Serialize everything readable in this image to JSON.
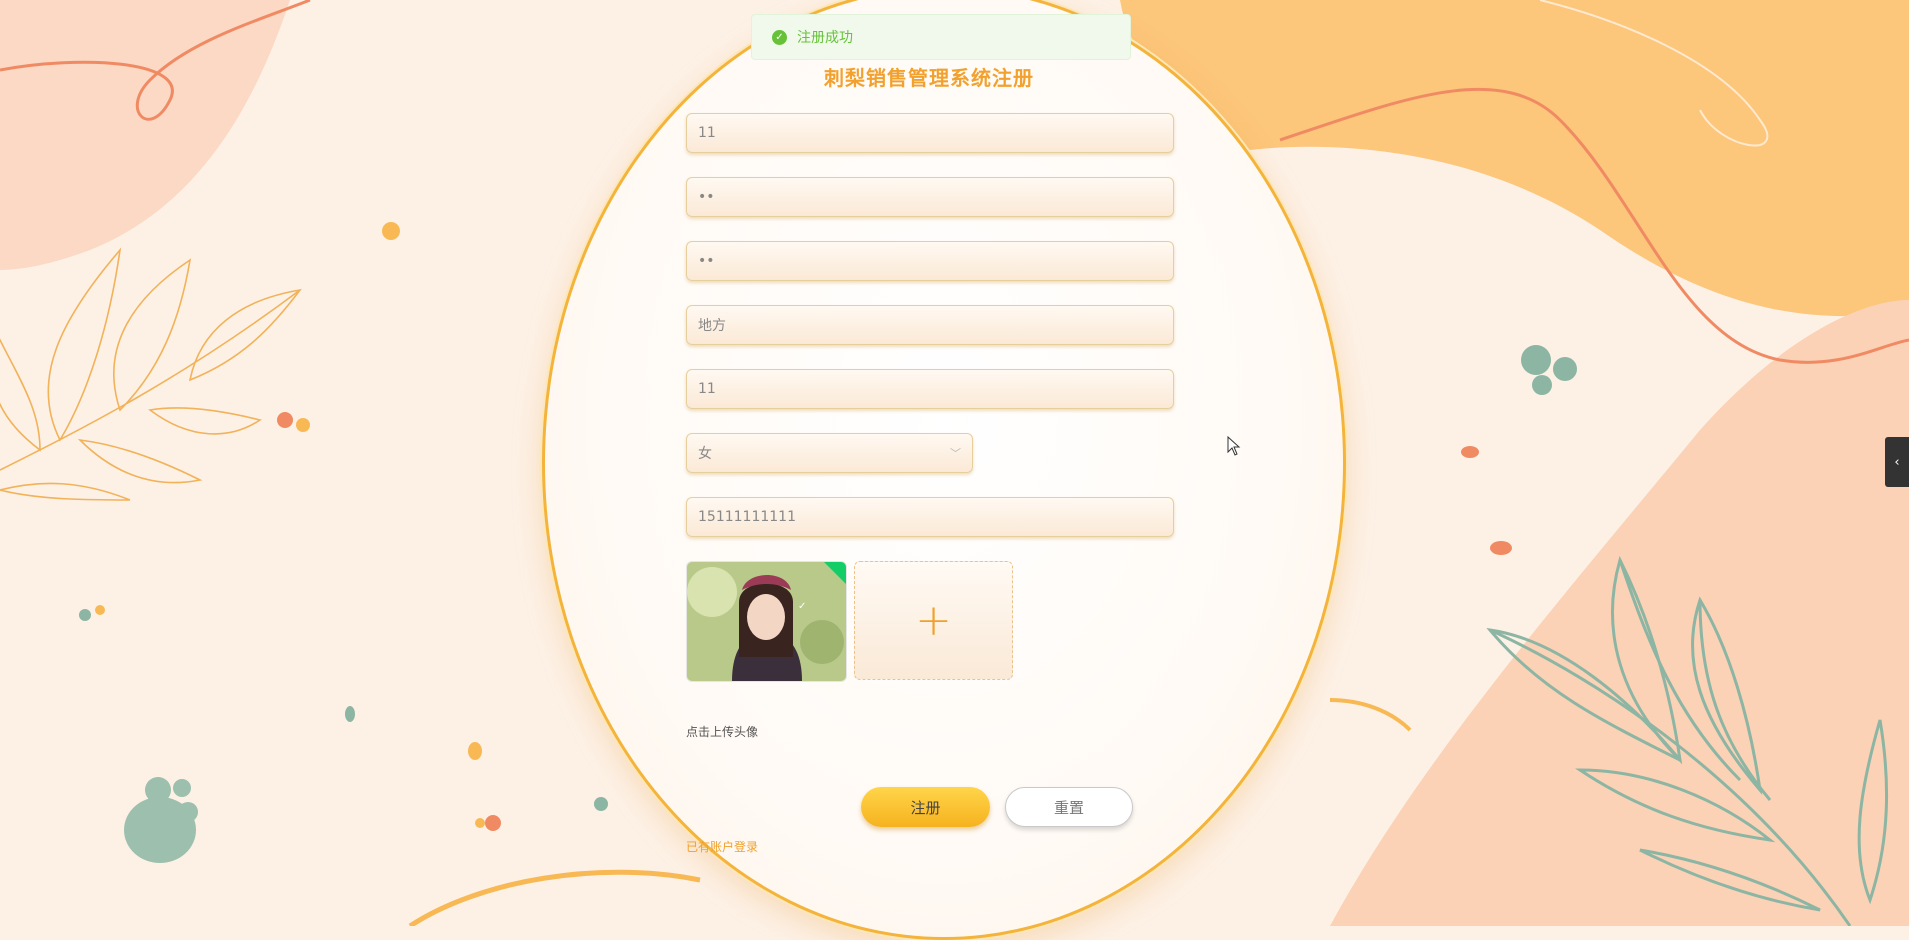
{
  "toast": {
    "message": "注册成功"
  },
  "form": {
    "title": "刺梨销售管理系统注册",
    "fields": [
      {
        "value": "11"
      },
      {
        "value": "••"
      },
      {
        "value": "••"
      },
      {
        "value": "地方"
      },
      {
        "value": "11"
      },
      {
        "value": "女"
      },
      {
        "value": "15111111111"
      }
    ],
    "upload_plus": "+",
    "upload_hint": "点击上传头像",
    "register_label": "注册",
    "reset_label": "重置",
    "login_link": "已有账户登录"
  },
  "side_tab": {
    "glyph": "‹"
  },
  "colors": {
    "accent": "#f3a12e",
    "success": "#67c23a",
    "button": "#f6b21f"
  }
}
